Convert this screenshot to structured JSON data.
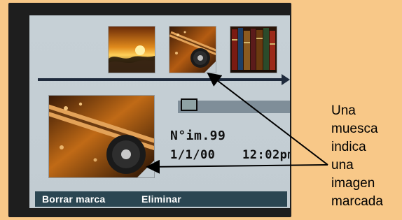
{
  "screen": {
    "image_number": "N°im.99",
    "date": "1/1/00",
    "time": "12:02pm"
  },
  "menu": {
    "items": [
      {
        "label": "Borrar marca"
      },
      {
        "label": "Eliminar"
      }
    ]
  },
  "callout": {
    "text": "Una\nmuesca\nindica\nuna\nimagen\nmarcada"
  },
  "thumbnails": [
    {
      "name": "sunset-beach-image"
    },
    {
      "name": "fishing-reel-image",
      "marked": true
    },
    {
      "name": "bookshelf-image"
    }
  ],
  "colors": {
    "background": "#f8c888",
    "bezel": "#1e1e1e",
    "screen": "#c2ccd2",
    "menu_bar": "#2b4652",
    "status_bar": "#7f8e99"
  }
}
